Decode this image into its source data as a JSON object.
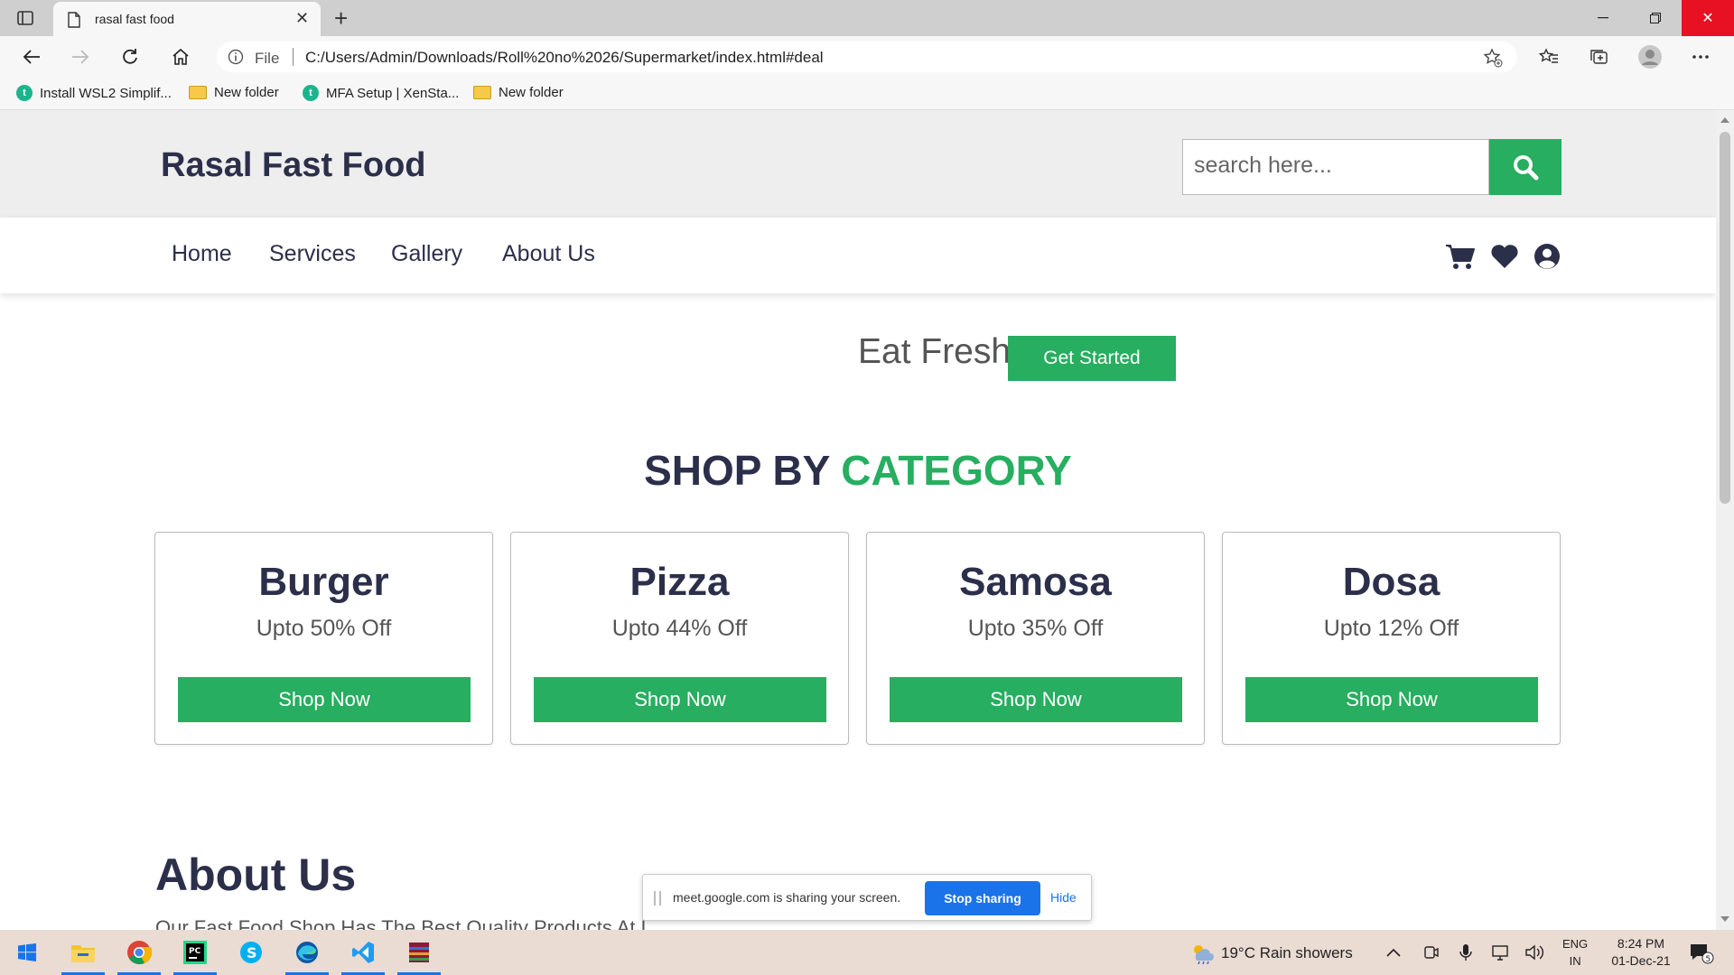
{
  "browser": {
    "tab_title": "rasal fast food",
    "address_label": "File",
    "url": "C:/Users/Admin/Downloads/Roll%20no%2026/Supermarket/index.html#deal",
    "bookmarks": [
      {
        "label": "Install WSL2 Simplif...",
        "icon": "teal-site-icon"
      },
      {
        "label": "New folder",
        "icon": "folder-icon"
      },
      {
        "label": "MFA Setup | XenSta...",
        "icon": "teal-site-icon"
      },
      {
        "label": "New folder",
        "icon": "folder-icon"
      }
    ]
  },
  "site": {
    "logo": "Rasal Fast Food",
    "search_placeholder": "search here...",
    "nav": [
      "Home",
      "Services",
      "Gallery",
      "About Us"
    ],
    "hero_text": "Eat Fresh",
    "hero_button": "Get Started",
    "section_title_a": "SHOP BY",
    "section_title_b": "CATEGORY",
    "categories": [
      {
        "name": "Burger",
        "offer": "Upto 50% Off",
        "button": "Shop Now"
      },
      {
        "name": "Pizza",
        "offer": "Upto 44% Off",
        "button": "Shop Now"
      },
      {
        "name": "Samosa",
        "offer": "Upto 35% Off",
        "button": "Shop Now"
      },
      {
        "name": "Dosa",
        "offer": "Upto 12% Off",
        "button": "Shop Now"
      }
    ],
    "about_title": "About Us",
    "about_text": "Our Fast Food Shop Has The Best Quality Products At L..."
  },
  "share_bar": {
    "message": "meet.google.com is sharing your screen.",
    "stop_label": "Stop sharing",
    "hide_label": "Hide"
  },
  "taskbar": {
    "weather": "19°C  Rain showers",
    "lang_1": "ENG",
    "lang_2": "IN",
    "time": "8:24 PM",
    "date": "01-Dec-21",
    "notification_count": "5"
  },
  "colors": {
    "accent_green": "#27ae60",
    "navy": "#2b2f4a",
    "stop_blue": "#1a73e8",
    "close_red": "#e81123"
  }
}
